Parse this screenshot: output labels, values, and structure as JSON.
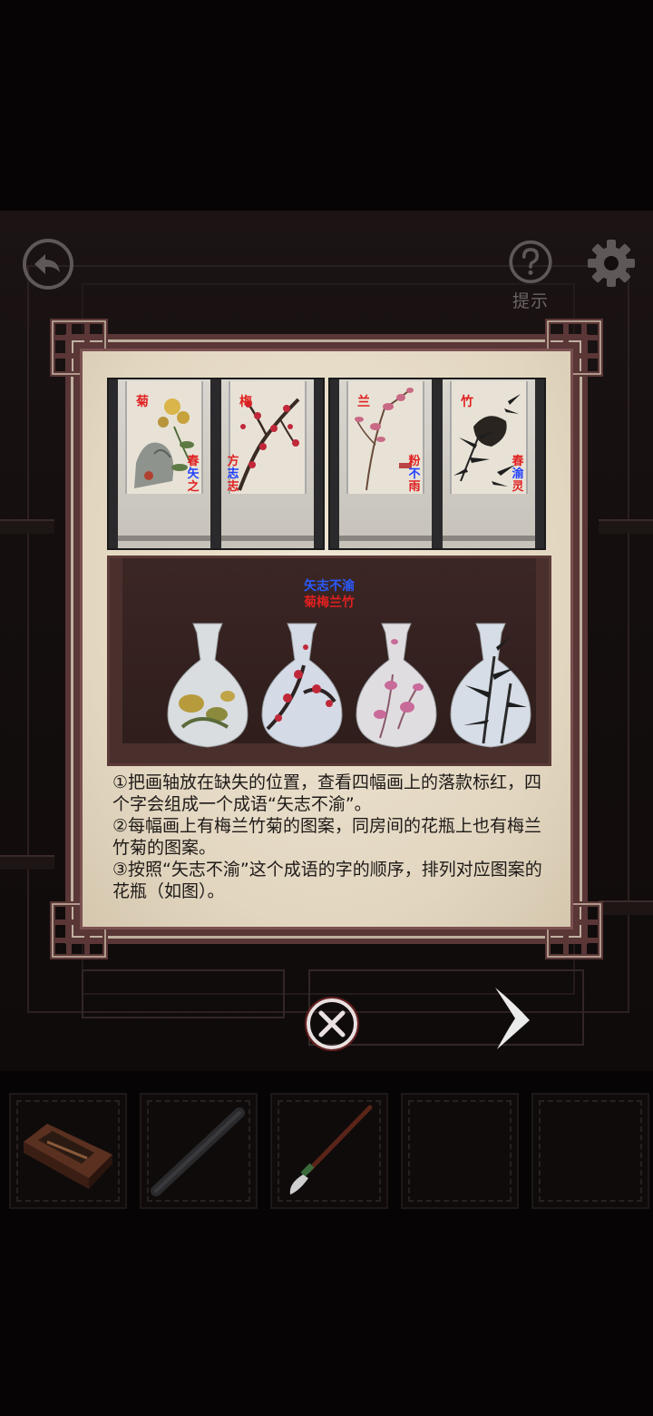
{
  "top_bar": {
    "back_icon": "back-arrow-icon",
    "hint_icon": "question-mark-icon",
    "hint_label": "提示",
    "settings_icon": "gear-icon"
  },
  "dialog": {
    "scroll_paintings": [
      {
        "top_char": "菊",
        "side_chars": [
          "春",
          "矢",
          "之"
        ],
        "subject": "chrysanthemum"
      },
      {
        "top_char": "梅",
        "side_chars": [
          "方",
          "志",
          "志"
        ],
        "subject": "plum blossom"
      },
      {
        "top_char": "兰",
        "side_chars": [
          "粉",
          "不",
          "雨"
        ],
        "subject": "orchid"
      },
      {
        "top_char": "竹",
        "side_chars": [
          "春",
          "渝",
          "灵"
        ],
        "subject": "bamboo"
      }
    ],
    "vase_caption_blue": "矢志不渝",
    "vase_caption_red": "菊梅兰竹",
    "vases": [
      "chrysanthemum-vase",
      "plum-vase",
      "orchid-vase",
      "bamboo-vase"
    ],
    "instructions": [
      "①把画轴放在缺失的位置，查看四幅画上的落款标红，四个字会组成一个成语“矢志不渝”。",
      "②每幅画上有梅兰竹菊的图案，同房间的花瓶上也有梅兰竹菊的图案。",
      "③按照“矢志不渝”这个成语的字的顺序，排列对应图案的花瓶（如图）。"
    ],
    "close_icon": "close-circle-icon",
    "next_icon": "chevron-right-icon"
  },
  "inventory": {
    "slots": [
      {
        "item": "matchbox"
      },
      {
        "item": "scroll-rod"
      },
      {
        "item": "calligraphy-brush"
      },
      {
        "item": ""
      },
      {
        "item": ""
      }
    ]
  },
  "colors": {
    "frame": "#5a3636",
    "paper": "#e8dcc6",
    "highlight_red": "#e02020",
    "highlight_blue": "#2040ff"
  }
}
